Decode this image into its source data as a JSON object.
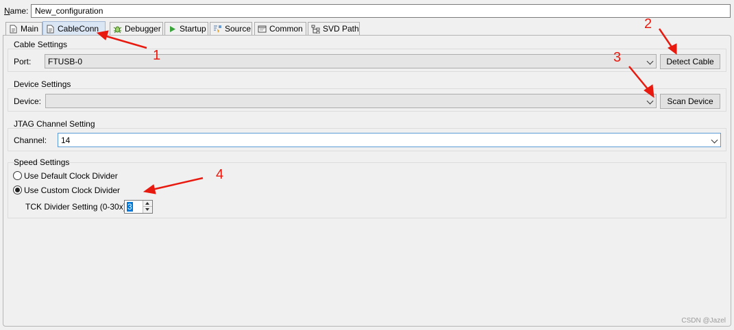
{
  "name_label": "Name:",
  "name_value": "New_configuration",
  "tabs": [
    {
      "label": "Main",
      "icon": "document-icon"
    },
    {
      "label": "CableConn",
      "icon": "document-icon"
    },
    {
      "label": "Debugger",
      "icon": "bug-icon"
    },
    {
      "label": "Startup",
      "icon": "play-icon"
    },
    {
      "label": "Source",
      "icon": "source-icon"
    },
    {
      "label": "Common",
      "icon": "window-icon"
    },
    {
      "label": "SVD Path",
      "icon": "tree-icon"
    }
  ],
  "active_tab": "CableConn",
  "cable_settings": {
    "title": "Cable Settings",
    "port_label": "Port:",
    "port_value": "FTUSB-0",
    "detect_button": "Detect Cable"
  },
  "device_settings": {
    "title": "Device Settings",
    "device_label": "Device:",
    "device_value": "",
    "scan_button": "Scan Device"
  },
  "jtag_settings": {
    "title": "JTAG Channel Setting",
    "channel_label": "Channel:",
    "channel_value": "14"
  },
  "speed_settings": {
    "title": "Speed Settings",
    "default_option": "Use Default Clock Divider",
    "custom_option": "Use Custom Clock Divider",
    "selected": "custom",
    "divider_label": "TCK Divider Setting (0-30x)",
    "divider_value": "3"
  },
  "annotations": [
    "1",
    "2",
    "3",
    "4"
  ],
  "annotation_color": "#e8190e",
  "watermark": "CSDN @Jazel"
}
